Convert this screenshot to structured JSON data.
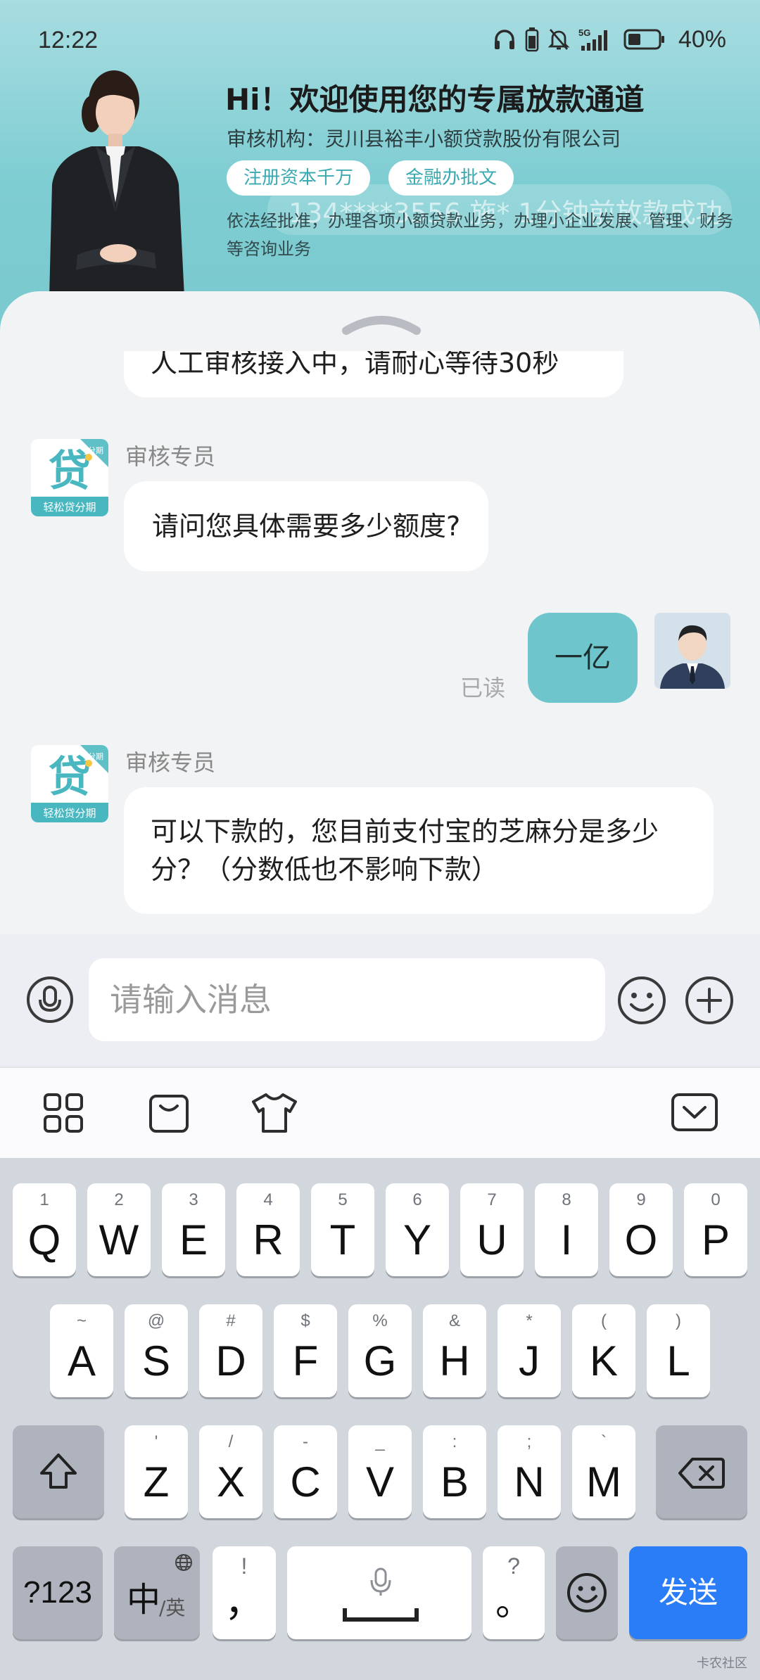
{
  "status_bar": {
    "time": "12:22",
    "battery_percent": "40%",
    "network": "5G",
    "icons": [
      "headphones-icon",
      "battery-small-icon",
      "mute-bell-icon",
      "signal-5g-icon",
      "battery-icon"
    ]
  },
  "header": {
    "title": "Hi！欢迎使用您的专属放款通道",
    "org": "审核机构：灵川县裕丰小额贷款股份有限公司",
    "tags": [
      "注册资本千万",
      "金融办批文"
    ],
    "ticker": "134****3556 施* 1分钟前放款成功",
    "description": "依法经批准，办理各项小额贷款业务，办理小企业发展、管理、财务等咨询业务"
  },
  "chat": {
    "partial_message": "人工审核接入中，请耐心等待30秒",
    "messages": [
      {
        "side": "left",
        "sender": "审核专员",
        "text": "请问您具体需要多少额度?"
      },
      {
        "side": "right",
        "text": "一亿",
        "status": "已读"
      },
      {
        "side": "left",
        "sender": "审核专员",
        "text": "可以下款的，您目前支付宝的芝麻分是多少分？（分数低也不影响下款）"
      }
    ],
    "bot_avatar": {
      "char": "贷",
      "caption": "轻松贷分期",
      "badge": "分期"
    }
  },
  "input_bar": {
    "placeholder": "请输入消息",
    "icons": [
      "microphone-icon",
      "emoji-icon",
      "plus-icon"
    ]
  },
  "keyboard": {
    "toolbar_icons": [
      "grid-apps-icon",
      "clipboard-icon",
      "tshirt-skin-icon",
      "collapse-keyboard-icon"
    ],
    "row1": [
      {
        "hint": "1",
        "key": "Q"
      },
      {
        "hint": "2",
        "key": "W"
      },
      {
        "hint": "3",
        "key": "E"
      },
      {
        "hint": "4",
        "key": "R"
      },
      {
        "hint": "5",
        "key": "T"
      },
      {
        "hint": "6",
        "key": "Y"
      },
      {
        "hint": "7",
        "key": "U"
      },
      {
        "hint": "8",
        "key": "I"
      },
      {
        "hint": "9",
        "key": "O"
      },
      {
        "hint": "0",
        "key": "P"
      }
    ],
    "row2": [
      {
        "hint": "~",
        "key": "A"
      },
      {
        "hint": "@",
        "key": "S"
      },
      {
        "hint": "#",
        "key": "D"
      },
      {
        "hint": "$",
        "key": "F"
      },
      {
        "hint": "%",
        "key": "G"
      },
      {
        "hint": "&",
        "key": "H"
      },
      {
        "hint": "*",
        "key": "J"
      },
      {
        "hint": "(",
        "key": "K"
      },
      {
        "hint": ")",
        "key": "L"
      }
    ],
    "row3": [
      {
        "hint": "'",
        "key": "Z"
      },
      {
        "hint": "/",
        "key": "X"
      },
      {
        "hint": "-",
        "key": "C"
      },
      {
        "hint": "_",
        "key": "V"
      },
      {
        "hint": ":",
        "key": "B"
      },
      {
        "hint": ";",
        "key": "N"
      },
      {
        "hint": "`",
        "key": "M"
      }
    ],
    "num_key": "?123",
    "lang_key_main": "中",
    "lang_key_sub": "/英",
    "comma_key": {
      "hint": "!",
      "key": "，"
    },
    "period_key": {
      "hint": "?",
      "key": "。"
    },
    "send_key": "发送"
  },
  "watermark": "卡农社区",
  "colors": {
    "header_teal": "#7ecdd2",
    "bubble_right": "#6ec6cc",
    "send_blue": "#2a7cf7",
    "tag_text": "#3aa9b1"
  }
}
